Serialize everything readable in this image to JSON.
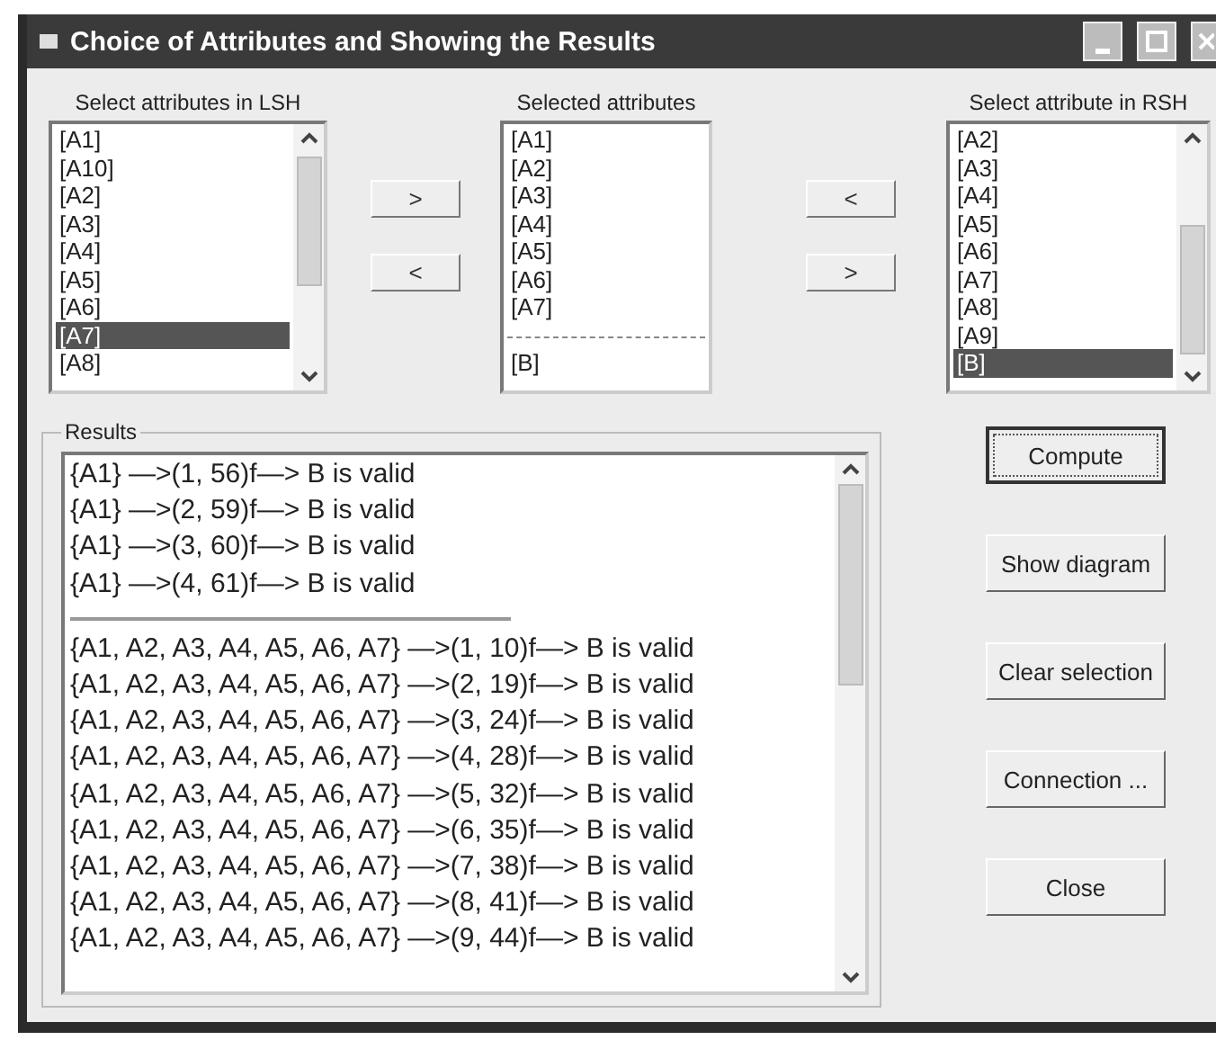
{
  "window": {
    "title": "Choice of Attributes and Showing the Results"
  },
  "lists": [
    {
      "label": "Select attributes in LSH",
      "items": [
        {
          "text": "[A1]",
          "selected": false
        },
        {
          "text": "[A10]",
          "selected": false
        },
        {
          "text": "[A2]",
          "selected": false
        },
        {
          "text": "[A3]",
          "selected": false
        },
        {
          "text": "[A4]",
          "selected": false
        },
        {
          "text": "[A5]",
          "selected": false
        },
        {
          "text": "[A6]",
          "selected": false
        },
        {
          "text": "[A7]",
          "selected": true
        },
        {
          "text": "[A8]",
          "selected": false
        }
      ]
    },
    {
      "label": "Selected attributes",
      "groups": [
        [
          "[A1]",
          "[A2]",
          "[A3]",
          "[A4]",
          "[A5]",
          "[A6]",
          "[A7]"
        ],
        [
          "[B]"
        ]
      ]
    },
    {
      "label": "Select attribute in RSH",
      "items": [
        {
          "text": "[A2]",
          "selected": false
        },
        {
          "text": "[A3]",
          "selected": false
        },
        {
          "text": "[A4]",
          "selected": false
        },
        {
          "text": "[A5]",
          "selected": false
        },
        {
          "text": "[A6]",
          "selected": false
        },
        {
          "text": "[A7]",
          "selected": false
        },
        {
          "text": "[A8]",
          "selected": false
        },
        {
          "text": "[A9]",
          "selected": false
        },
        {
          "text": "[B]",
          "selected": true
        }
      ]
    }
  ],
  "left_buttons": [
    ">",
    "<"
  ],
  "right_buttons": [
    "<",
    ">"
  ],
  "results": {
    "label": "Results",
    "groups": [
      [
        "{A1} —>(1, 56)f—> B is valid",
        "{A1} —>(2, 59)f—> B is valid",
        "{A1} —>(3, 60)f—> B is valid",
        "{A1} —>(4, 61)f—> B is valid"
      ],
      [
        "{A1, A2, A3, A4, A5, A6, A7} —>(1, 10)f—> B is valid",
        "{A1, A2, A3, A4, A5, A6, A7} —>(2, 19)f—> B is valid",
        "{A1, A2, A3, A4, A5, A6, A7} —>(3, 24)f—> B is valid",
        "{A1, A2, A3, A4, A5, A6, A7} —>(4, 28)f—> B is valid",
        "{A1, A2, A3, A4, A5, A6, A7} —>(5, 32)f—> B is valid",
        "{A1, A2, A3, A4, A5, A6, A7} —>(6, 35)f—> B is valid",
        "{A1, A2, A3, A4, A5, A6, A7} —>(7, 38)f—> B is valid",
        "{A1, A2, A3, A4, A5, A6, A7} —>(8, 41)f—> B is valid",
        "{A1, A2, A3, A4, A5, A6, A7} —>(9, 44)f—> B is valid"
      ]
    ]
  },
  "actions": [
    {
      "label": "Compute",
      "selected": true
    },
    {
      "label": "Show diagram",
      "selected": false
    },
    {
      "label": "Clear selection",
      "selected": false
    },
    {
      "label": "Connection ...",
      "selected": false
    },
    {
      "label": "Close",
      "selected": false
    }
  ]
}
